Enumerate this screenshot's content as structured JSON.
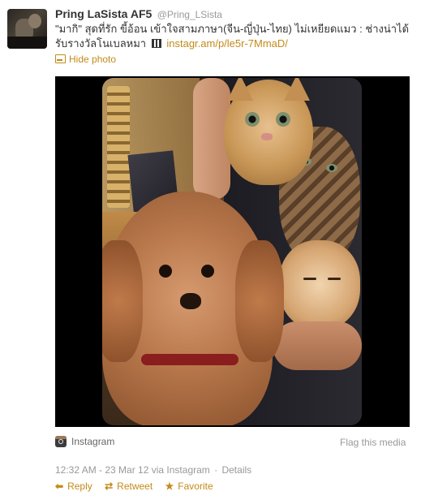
{
  "user": {
    "full_name": "Pring LaSista AF5",
    "screen_name": "@Pring_LSista"
  },
  "tweet": {
    "text": "\"มากิ\" สุดที่รัก ขี้อ้อน เข้าใจสามภาษา(จีน-ญี่ปุ่น-ไทย) ไม่เหยียดแมว : ช่างน่าได้รับรางวัลโนเบลหมา",
    "link": "instagr.am/p/le5r-7MmaD/"
  },
  "hide_photo_label": "Hide photo",
  "media": {
    "source_label": "Instagram",
    "flag_label": "Flag this media"
  },
  "meta": {
    "timestamp": "12:32 AM - 23 Mar 12",
    "via": "via Instagram",
    "separator": "·",
    "details_label": "Details"
  },
  "actions": {
    "reply": "Reply",
    "retweet": "Retweet",
    "favorite": "Favorite"
  },
  "colors": {
    "link": "#c38a1a",
    "muted": "#999999",
    "text": "#333333"
  },
  "icons": {
    "hide_photo": "photo-icon",
    "source": "instagram-icon",
    "reply": "reply-arrow-icon",
    "retweet": "retweet-icon",
    "favorite": "star-icon"
  }
}
